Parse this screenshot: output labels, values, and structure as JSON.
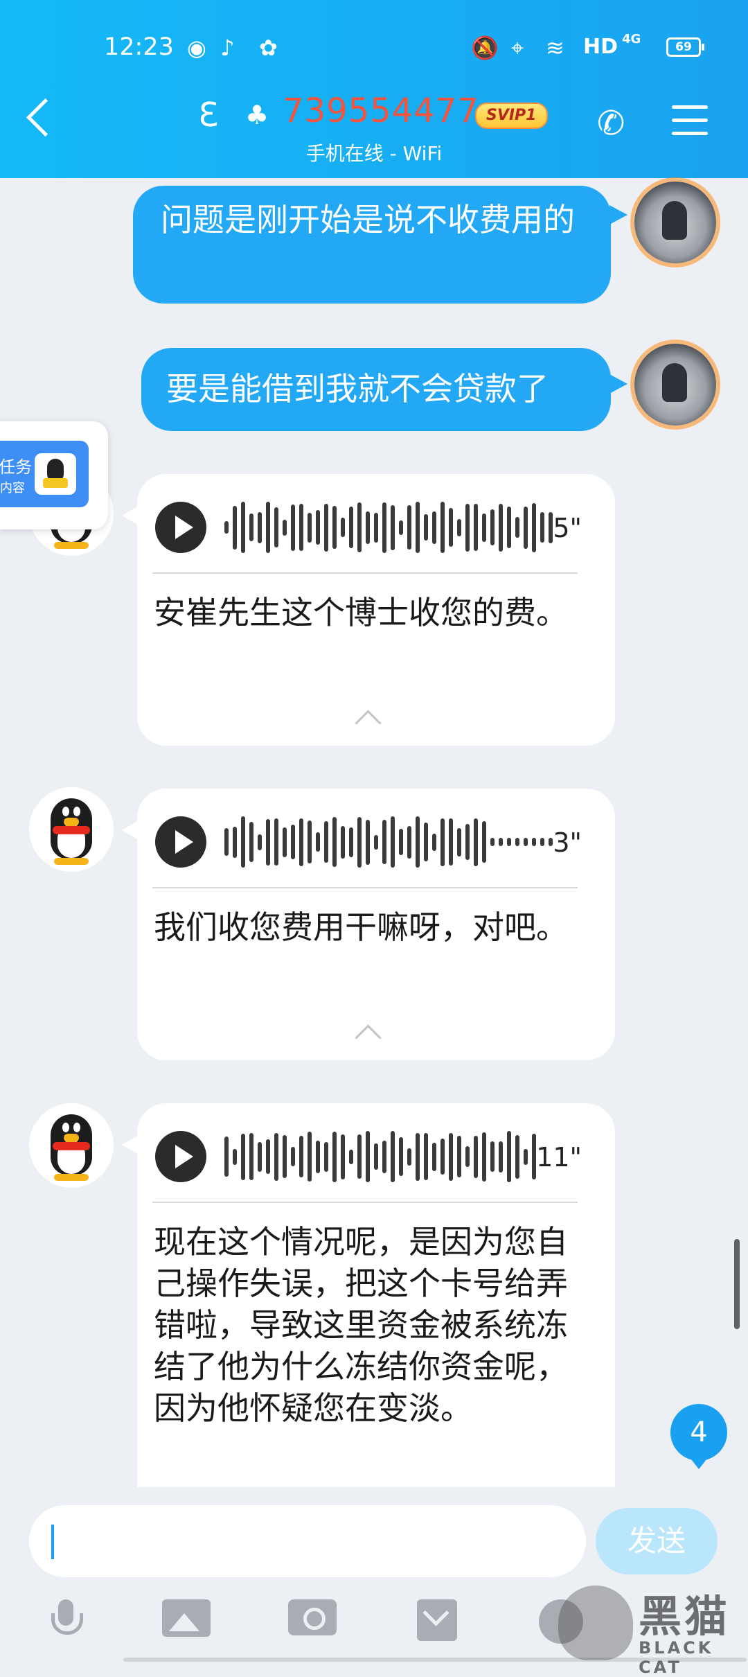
{
  "status_bar": {
    "time": "12:23",
    "network": "HD",
    "network_type": "4G",
    "battery": "69"
  },
  "header": {
    "contact_id": "739554477",
    "vip_badge": "SVIP1",
    "status": "手机在线 - WiFi"
  },
  "messages": [
    {
      "type": "outgoing",
      "text": "问题是刚开始是说不收费用的"
    },
    {
      "type": "outgoing",
      "text": "要是能借到我就不会贷款了"
    },
    {
      "type": "incoming_voice",
      "duration": "5\"",
      "transcript": "安崔先生这个博士收您的费。"
    },
    {
      "type": "incoming_voice",
      "duration": "3\"",
      "transcript": "我们收您费用干嘛呀，对吧。"
    },
    {
      "type": "incoming_voice",
      "duration": "11\"",
      "transcript": "现在这个情况呢，是因为您自己操作失误，把这个卡号给弄错啦，导致这里资金被系统冻结了他为什么冻结你资金呢，因为他怀疑您在变淡。"
    }
  ],
  "floating_widget": {
    "line1": "任务",
    "line2": "内容"
  },
  "unread_count": "4",
  "composer": {
    "input_value": "",
    "send_label": "发送"
  },
  "watermark": {
    "cn": "黑猫",
    "en": "BLACK CAT"
  },
  "colors": {
    "header": "#14b9f7",
    "outgoing_bubble": "#23a8f5",
    "contact_id": "#f5533d"
  }
}
